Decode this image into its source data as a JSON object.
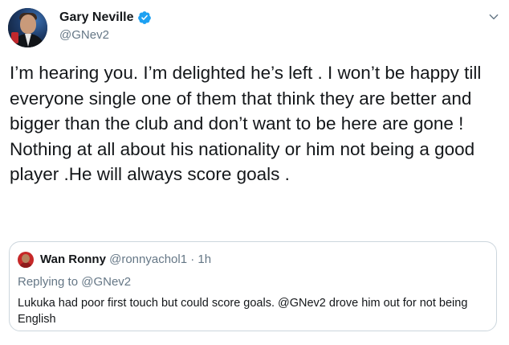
{
  "author": {
    "display_name": "Gary Neville",
    "handle": "@GNev2",
    "verified": true,
    "avatar_icon": "profile-photo"
  },
  "tweet": {
    "text": "I’m hearing you. I’m delighted he’s left . I won’t be happy till everyone single one of them that think they are better and bigger than the club and don’t want to be here are gone ! Nothing at all about his nationality or him not being a good player .He will always score goals ."
  },
  "quoted_tweet": {
    "display_name": "Wan Ronny",
    "handle": "@ronnyachol1",
    "separator": "·",
    "time": "1h",
    "replying_prefix": "Replying to ",
    "replying_to": "@GNev2",
    "text": "Lukuka had poor first touch but could score goals. @GNev2  drove him out for not being English"
  },
  "icons": {
    "verified": "verified-badge-icon",
    "menu": "chevron-down-icon"
  },
  "colors": {
    "verified_blue": "#1da1f2",
    "secondary_text": "#657786",
    "border": "#ccd6dd"
  }
}
